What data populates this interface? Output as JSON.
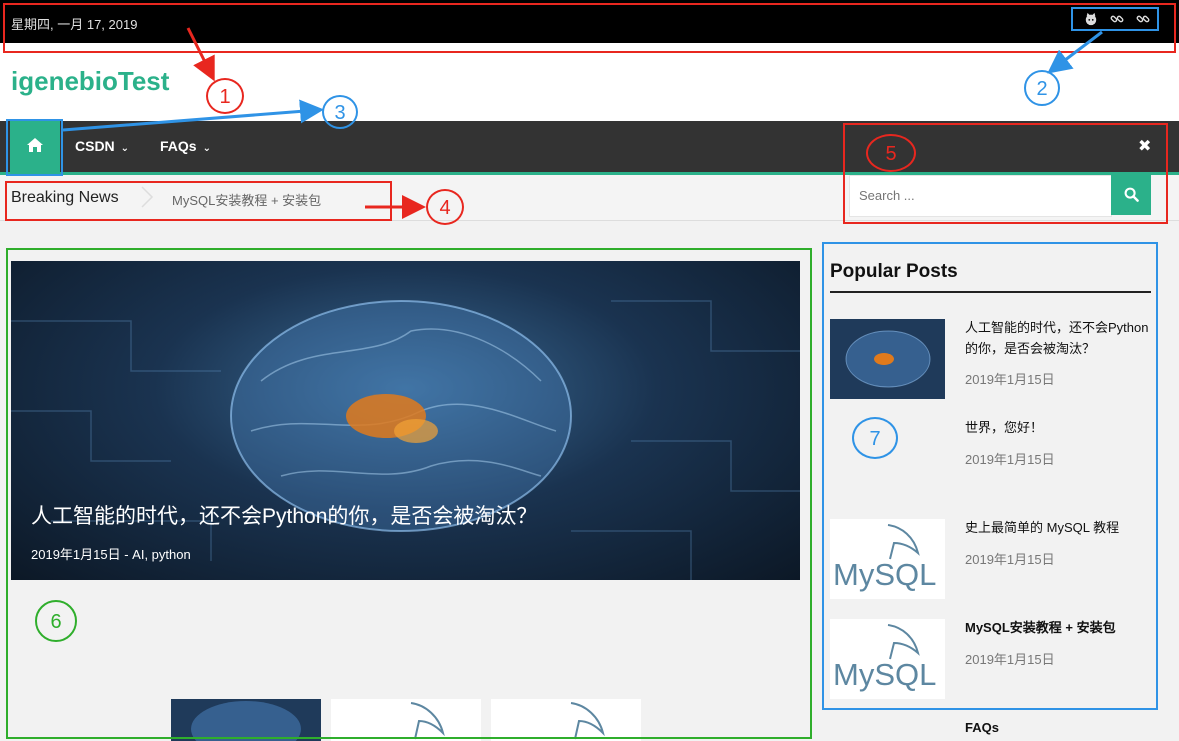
{
  "topbar": {
    "date": "星期四, 一月 17, 2019",
    "social_icons": [
      "github-icon",
      "link-icon",
      "link-icon"
    ]
  },
  "header": {
    "site_title": "igenebioTest"
  },
  "nav": {
    "home_icon": "home-icon",
    "items": [
      {
        "label": "CSDN"
      },
      {
        "label": "FAQs"
      }
    ],
    "close_icon": "close-icon"
  },
  "breaking": {
    "label": "Breaking News",
    "headline": "MySQL安装教程 + 安装包"
  },
  "search": {
    "placeholder": "Search ...",
    "button_icon": "search-icon"
  },
  "featured": {
    "title": "人工智能的时代，还不会Python的你，是否会被淘汰？",
    "meta": "2019年1月15日 - AI, python"
  },
  "popular": {
    "heading": "Popular Posts",
    "posts": [
      {
        "title": "人工智能的时代，还不会Python的你，是否会被淘汰？",
        "date": "2019年1月15日",
        "thumb": "brain"
      },
      {
        "title": "世界，您好！",
        "date": "2019年1月15日",
        "thumb": "none"
      },
      {
        "title": "史上最简单的 MySQL 教程",
        "date": "2019年1月15日",
        "thumb": "mysql"
      },
      {
        "title": "MySQL安装教程 + 安装包",
        "date": "2019年1月15日",
        "thumb": "mysql"
      }
    ]
  },
  "widget_faqs": "FAQs",
  "thumb_logo_text": "MySQL",
  "annotations": {
    "labels": [
      "1",
      "2",
      "3",
      "4",
      "5",
      "6",
      "7"
    ],
    "colors": {
      "red": "#e8271f",
      "blue": "#2f93e6",
      "green": "#2fae2c"
    }
  },
  "colors": {
    "accent": "#2bb18a",
    "nav_bg": "#333333",
    "topbar_bg": "#000000"
  }
}
